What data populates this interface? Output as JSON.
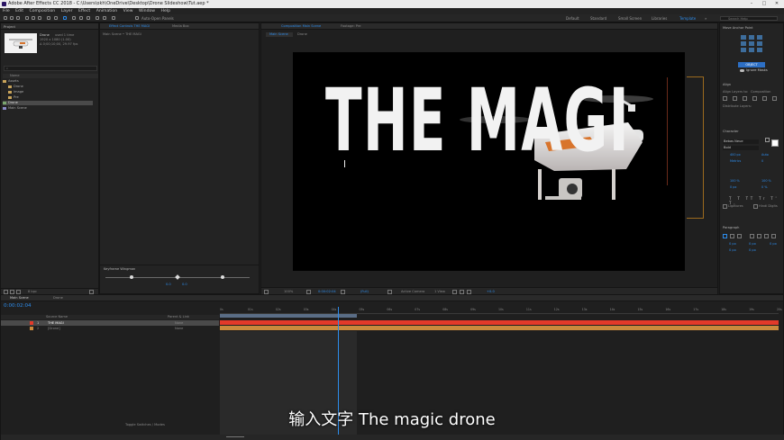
{
  "app": {
    "window_title": "Adobe After Effects CC 2018 - C:\\Users\\okh\\OneDrive\\Desktop\\Drone Slideshow\\Tut.aep *"
  },
  "menu": [
    "File",
    "Edit",
    "Composition",
    "Layer",
    "Effect",
    "Animation",
    "View",
    "Window",
    "Help"
  ],
  "toolbar": {
    "auto_open_panels": "Auto-Open Panels",
    "workspaces": [
      "Default",
      "Standard",
      "Small Screen",
      "Libraries",
      "Template"
    ],
    "active_workspace": "Template",
    "search_placeholder": "Search Help"
  },
  "project": {
    "title": "Project",
    "selected_name": "Drone",
    "used_count": "used 1 time",
    "details_line1": "1920 x 1080 (1.00)",
    "details_line2": "Δ 0;00;10;00, 29.97 fps",
    "search_placeholder": "",
    "column_name": "Name",
    "items": [
      {
        "name": "Assets",
        "kind": "folder",
        "selected": false
      },
      {
        "name": "Drone",
        "kind": "folder",
        "selected": false
      },
      {
        "name": "Image",
        "kind": "folder",
        "selected": false
      },
      {
        "name": "Pre",
        "kind": "folder",
        "selected": false
      },
      {
        "name": "Drone",
        "kind": "footage",
        "selected": true
      },
      {
        "name": "Main Scene",
        "kind": "comp",
        "selected": false
      }
    ],
    "bpc": "8 bpc"
  },
  "effect_controls": {
    "tab_label": "Effect Controls THE MAGI",
    "tab2": "Media Box",
    "breadcrumb": "Main Scene • THE MAGI",
    "anyframe_title": "Keyframe Wingman",
    "sub_labels": [
      "0.0",
      "0.0"
    ]
  },
  "composition": {
    "tab_label": "Composition Main Scene",
    "tab2": "Footage: Pre",
    "subtabs": [
      "Main Scene",
      "Drone"
    ],
    "canvas_text": "THE MAGI",
    "footer": {
      "zoom": "100%",
      "timecode": "0:00:02:04",
      "resolution": "(Full)",
      "camera": "Active Camera",
      "views": "1 View",
      "exposure": "+0.0"
    }
  },
  "right_panels": {
    "anchor": {
      "title": "Move Anchor Point",
      "object_btn": "OBJECT",
      "ignore_masks": "Ignore Masks"
    },
    "align": {
      "title": "Align",
      "align_layers_to": "Align Layers to:",
      "target": "Composition",
      "distribute": "Distribute Layers:"
    },
    "character": {
      "title": "Character",
      "font": "Bebas Neue",
      "style": "Bold",
      "size": "400 px",
      "leading": "Auto",
      "tracking": "0",
      "kerning": "Metrics",
      "vscale": "100 %",
      "hscale": "100 %",
      "baseline": "0 px",
      "tsume": "0 %",
      "ligatures": "Ligatures",
      "hindi_digits": "Hindi Digits"
    },
    "paragraph": {
      "title": "Paragraph",
      "indents": [
        "0 px",
        "0 px",
        "0 px",
        "0 px",
        "0 px"
      ]
    }
  },
  "timeline": {
    "tab": "Main Scene",
    "tab2": "Drone",
    "timecode": "0:00:02:04",
    "col_source": "Source Name",
    "col_parent": "Parent & Link",
    "layers": [
      {
        "index": "1",
        "name": "THE MAGI",
        "parent": "None",
        "color": "#e23a2a",
        "selected": true
      },
      {
        "index": "2",
        "name": "[Drone]",
        "parent": "None",
        "color": "#c98a3d",
        "selected": false
      }
    ],
    "ruler": [
      "0s",
      "01s",
      "02s",
      "03s",
      "04s",
      "05s",
      "06s",
      "07s",
      "08s",
      "09s",
      "10s",
      "11s",
      "12s",
      "13s",
      "14s",
      "15s",
      "16s",
      "17s",
      "18s",
      "19s",
      "20s"
    ],
    "footer": "Toggle Switches / Modes",
    "playhead": 0.22
  },
  "subtitle": "输入文字 The magic drone"
}
